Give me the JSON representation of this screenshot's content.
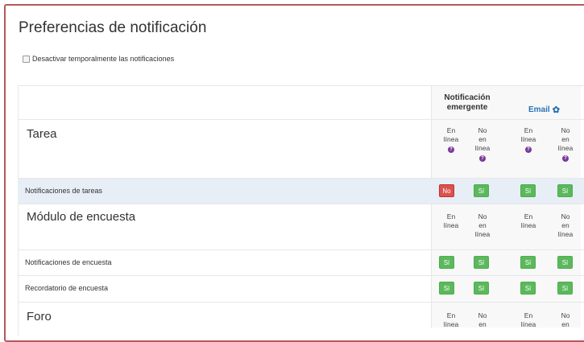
{
  "page": {
    "title": "Preferencias de notificación"
  },
  "disable_toggle": {
    "label": "Desactivar temporalmente las notificaciones",
    "checked": false
  },
  "columns": {
    "popup": {
      "label": "Notificación emergente"
    },
    "email": {
      "label": "Email",
      "icon": "gear-icon"
    },
    "online_label": "En línea",
    "offline_words": [
      "No",
      "en",
      "línea"
    ]
  },
  "sections": [
    {
      "title": "Tarea",
      "rows": [
        {
          "label": "Notificaciones de tareas",
          "popup_online": "No",
          "popup_offline": "Sí",
          "email_online": "Sí",
          "email_offline": "Sí"
        }
      ]
    },
    {
      "title": "Módulo de encuesta",
      "rows": [
        {
          "label": "Notificaciones de encuesta",
          "popup_online": "Sí",
          "popup_offline": "Sí",
          "email_online": "Sí",
          "email_offline": "Sí"
        },
        {
          "label": "Recordatorio de encuesta",
          "popup_online": "Sí",
          "popup_offline": "Sí",
          "email_online": "Sí",
          "email_offline": "Sí"
        }
      ]
    },
    {
      "title": "Foro",
      "rows": []
    }
  ],
  "colors": {
    "on": "#5cb85c",
    "off": "#d9534f",
    "frame": "#b5585b",
    "help": "#7a3a9a"
  }
}
